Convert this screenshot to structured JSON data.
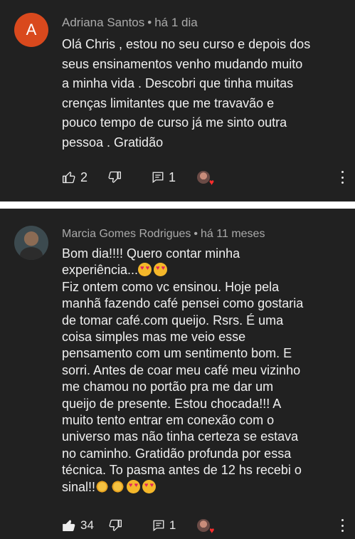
{
  "comments": [
    {
      "author": "Adriana Santos",
      "time": "há 1 dia",
      "avatar_letter": "A",
      "avatar_color": "#d9491d",
      "text_lines": [
        "Olá Chris , estou no seu curso e depois dos",
        "seus ensinamentos venho mudando muito",
        "a minha vida . Descobri que tinha muitas",
        "crenças limitantes que me travavão e",
        "pouco tempo de curso já me sinto outra",
        "pessoa  . Gratidão"
      ],
      "likes": "2",
      "replies": "1",
      "liked": false,
      "creator_heart": true
    },
    {
      "author": "Marcia Gomes Rodrigues",
      "time": "há 11 meses",
      "text_lines": [
        "Bom dia!!!! Quero contar minha",
        "experiência...",
        "Fiz ontem como vc ensinou. Hoje pela",
        "manhã fazendo café pensei como gostaria",
        "de tomar café.com queijo. Rsrs. É uma",
        "coisa simples mas me veio esse",
        "pensamento com um sentimento bom. E",
        "sorri. Antes de coar meu café meu vizinho",
        "me chamou no portão pra me dar um",
        "queijo de presente. Estou chocada!!! A",
        "muito tento entrar em conexão com o",
        "universo mas não tinha certeza se estava",
        "no caminho. Gratidão profunda por essa",
        "técnica. To pasma antes de 12 hs recebi o",
        "sinal!!"
      ],
      "likes": "34",
      "replies": "1",
      "liked": true,
      "creator_heart": true
    }
  ],
  "separator": "•",
  "icons": [
    "like-icon",
    "dislike-icon",
    "reply-icon",
    "creator-heart-icon",
    "more-options-icon",
    "heart-eyes-emoji",
    "sun-emoji"
  ]
}
